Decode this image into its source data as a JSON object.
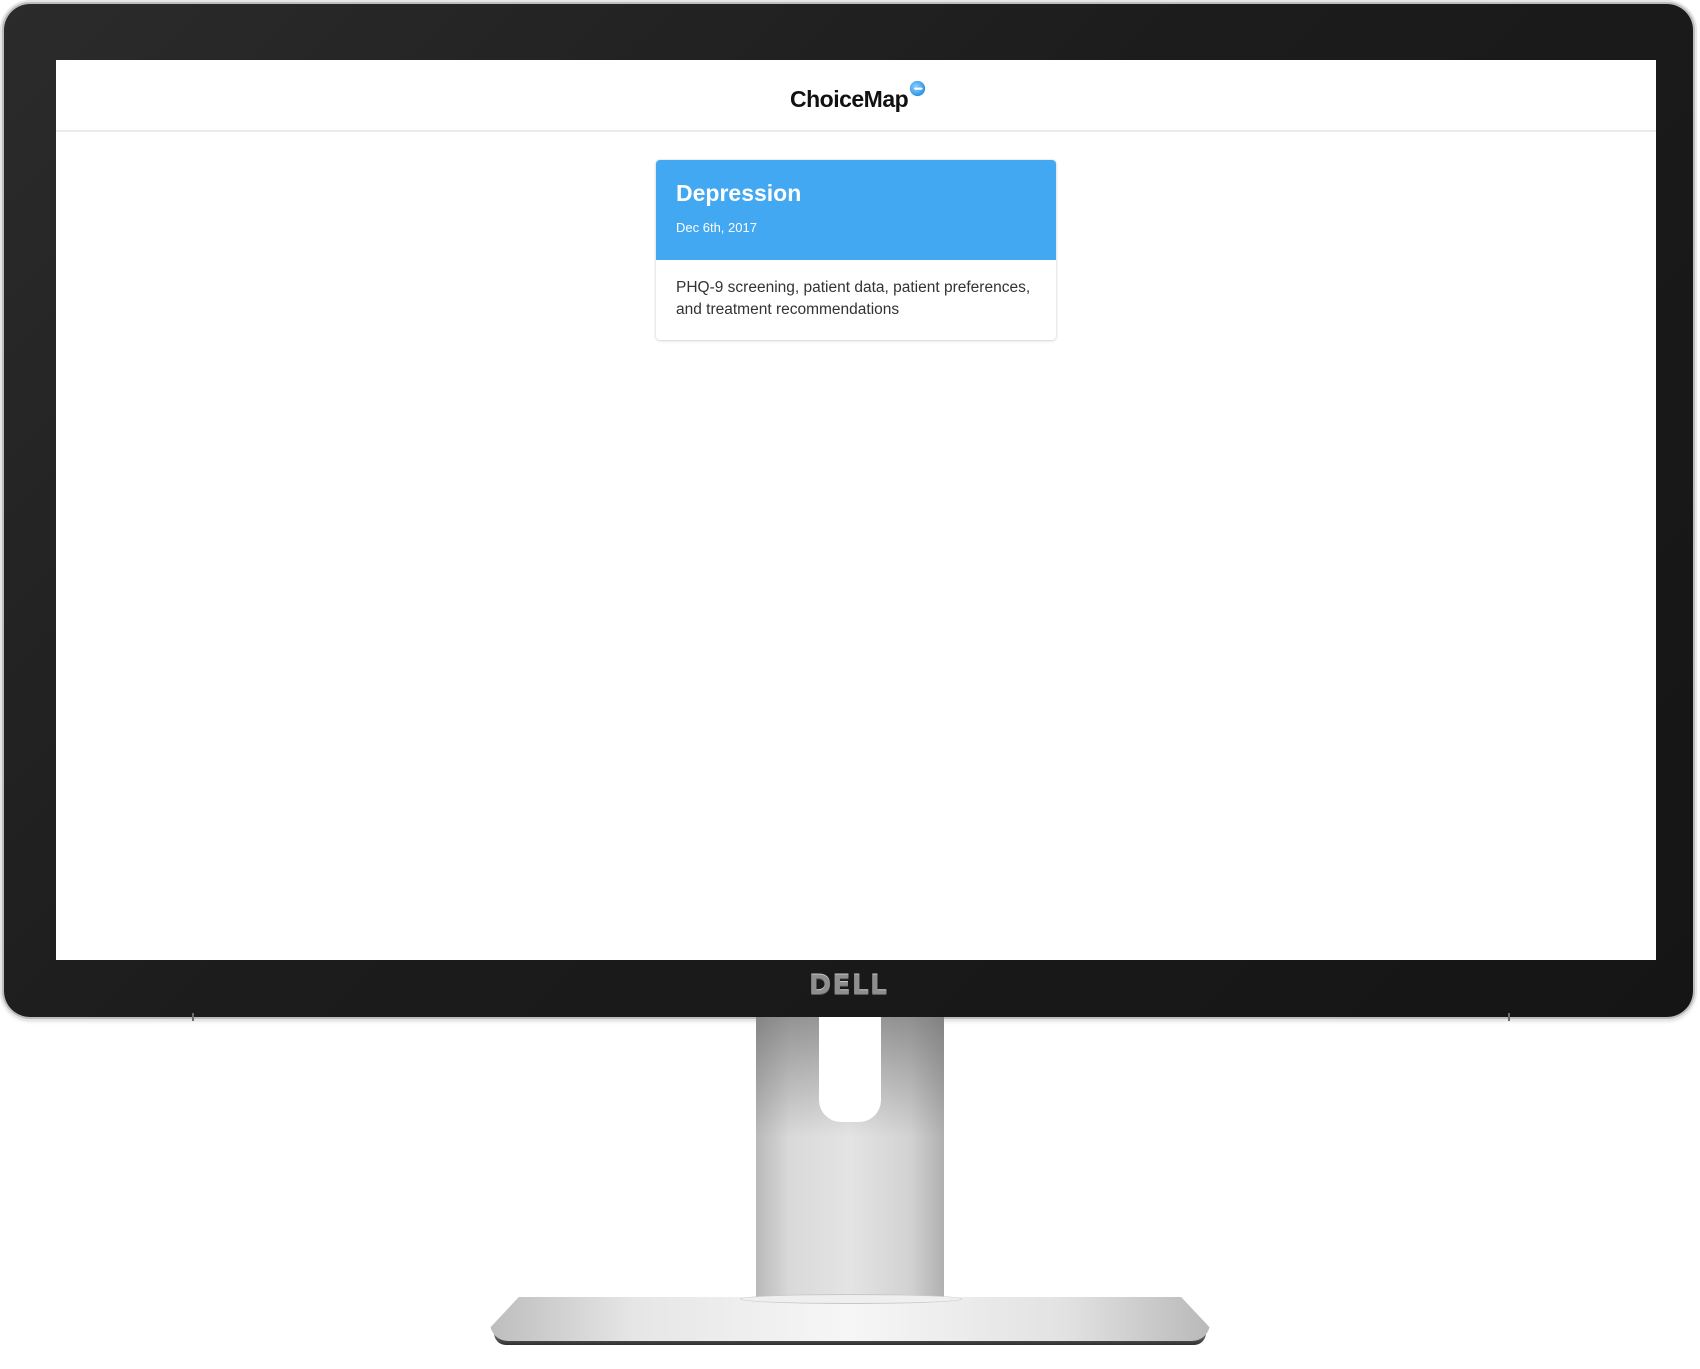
{
  "device": {
    "brand_label": "DELL"
  },
  "app": {
    "logo_text": "ChoiceMap",
    "accent_color": "#42a8f2"
  },
  "cards": [
    {
      "title": "Depression",
      "date": "Dec 6th, 2017",
      "description": "PHQ-9 screening, patient data, patient preferences, and treatment recommendations"
    }
  ]
}
